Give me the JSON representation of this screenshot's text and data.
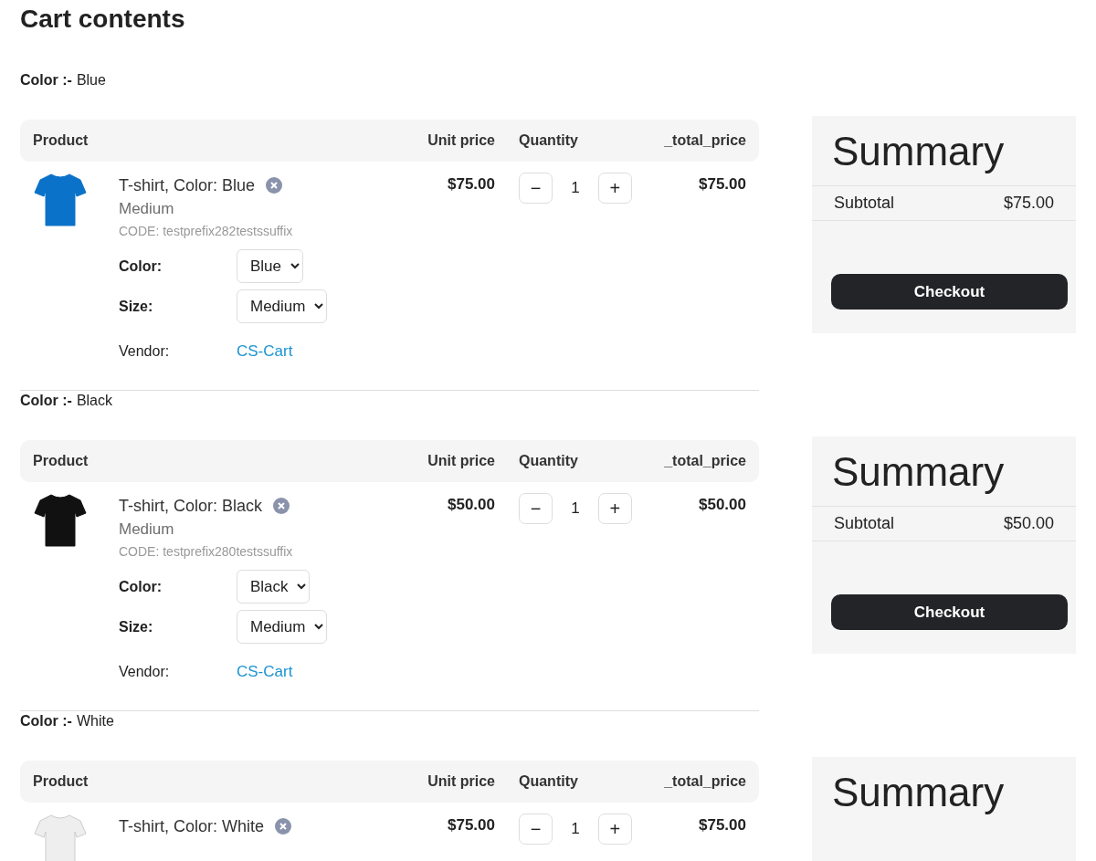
{
  "page": {
    "title": "Cart contents"
  },
  "groups": [
    {
      "label": "Color :-",
      "value": "Blue",
      "columns": [
        "Product",
        "Unit price",
        "Quantity",
        "_total_price"
      ],
      "item": {
        "color": "#0a72c8",
        "name": "T-shirt, Color: Blue",
        "variant": "Medium",
        "code": "CODE: testprefix282testssuffix",
        "unit_price": "$75.00",
        "decrease": "−",
        "quantity": "1",
        "increase": "+",
        "total": "$75.00",
        "options": [
          {
            "label": "Color:",
            "value": "Blue"
          },
          {
            "label": "Size:",
            "value": "Medium"
          }
        ],
        "vendor": {
          "label": "Vendor:",
          "value": "CS-Cart"
        }
      },
      "summary": {
        "title": "Summary",
        "subtotal_label": "Subtotal",
        "subtotal": "$75.00",
        "button": "Checkout"
      }
    },
    {
      "label": "Color :-",
      "value": "Black",
      "columns": [
        "Product",
        "Unit price",
        "Quantity",
        "_total_price"
      ],
      "item": {
        "color": "#111111",
        "name": "T-shirt, Color: Black",
        "variant": "Medium",
        "code": "CODE: testprefix280testssuffix",
        "unit_price": "$50.00",
        "decrease": "−",
        "quantity": "1",
        "increase": "+",
        "total": "$50.00",
        "options": [
          {
            "label": "Color:",
            "value": "Black"
          },
          {
            "label": "Size:",
            "value": "Medium"
          }
        ],
        "vendor": {
          "label": "Vendor:",
          "value": "CS-Cart"
        }
      },
      "summary": {
        "title": "Summary",
        "subtotal_label": "Subtotal",
        "subtotal": "$50.00",
        "button": "Checkout"
      }
    },
    {
      "label": "Color :-",
      "value": "White",
      "columns": [
        "Product",
        "Unit price",
        "Quantity",
        "_total_price"
      ],
      "item": {
        "color": "#eeeeee",
        "name": "T-shirt, Color: White",
        "unit_price": "$75.00",
        "decrease": "−",
        "quantity": "1",
        "increase": "+",
        "total": "$75.00"
      },
      "summary": {
        "title": "Summary"
      }
    }
  ]
}
